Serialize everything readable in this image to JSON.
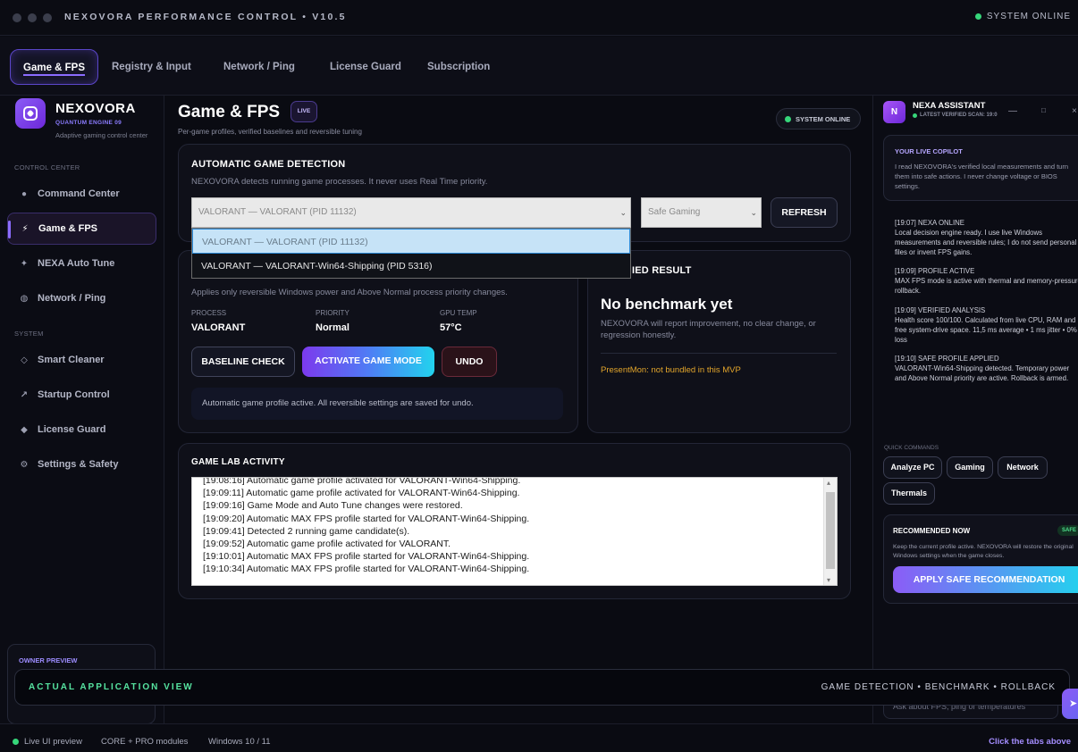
{
  "window": {
    "title": "NEXOVORA PERFORMANCE CONTROL • V10.5",
    "status": "SYSTEM ONLINE"
  },
  "tabs": [
    {
      "label": "Game & FPS"
    },
    {
      "label": "Registry & Input"
    },
    {
      "label": "Network / Ping"
    },
    {
      "label": "License Guard"
    },
    {
      "label": "Subscription"
    }
  ],
  "sidebar": {
    "brand": "NEXOVORA",
    "engine": "QUANTUM ENGINE 09",
    "tagline": "Adaptive gaming control center",
    "section_control": "CONTROL CENTER",
    "section_system": "SYSTEM",
    "items": [
      {
        "label": "Command Center",
        "icon": "grid-dot-icon"
      },
      {
        "label": "Game & FPS",
        "icon": "bolt-icon"
      },
      {
        "label": "NEXA Auto Tune",
        "icon": "sparkle-icon"
      },
      {
        "label": "Network / Ping",
        "icon": "network-icon"
      },
      {
        "label": "Smart Cleaner",
        "icon": "diamond-icon"
      },
      {
        "label": "Startup Control",
        "icon": "arrow-icon"
      },
      {
        "label": "License Guard",
        "icon": "shield-icon"
      },
      {
        "label": "Settings & Safety",
        "icon": "gear-icon"
      }
    ],
    "owner_preview": "OWNER PREVIEW"
  },
  "main": {
    "title": "Game & FPS",
    "badge": "LIVE",
    "subtitle": "Per-game profiles, verified baselines and reversible tuning",
    "system_pill": "SYSTEM ONLINE",
    "detection": {
      "heading": "AUTOMATIC GAME DETECTION",
      "description": "NEXOVORA detects running game processes. It never uses Real Time priority.",
      "selected_process": "VALORANT — VALORANT (PID 11132)",
      "mode_value": "Safe Gaming",
      "refresh_label": "REFRESH",
      "dropdown_options": [
        "VALORANT — VALORANT (PID 11132)",
        "VALORANT — VALORANT-Win64-Shipping (PID 5316)"
      ]
    },
    "game_mode": {
      "description": "Applies only reversible Windows power and Above Normal process priority changes.",
      "stats": [
        {
          "label": "PROCESS",
          "value": "VALORANT"
        },
        {
          "label": "PRIORITY",
          "value": "Normal"
        },
        {
          "label": "GPU TEMP",
          "value": "57°C"
        }
      ],
      "baseline_label": "BASELINE CHECK",
      "activate_label": "ACTIVATE GAME MODE",
      "undo_label": "UNDO",
      "notice": "Automatic game profile active. All reversible settings are saved for undo."
    },
    "benchmark": {
      "heading": "IED RESULT",
      "result": "No benchmark yet",
      "description": "NEXOVORA will report improvement, no clear change, or regression honestly.",
      "presentmon": "PresentMon: not bundled in this MVP"
    },
    "activity": {
      "heading": "GAME LAB ACTIVITY",
      "lines": [
        "[19:08:16] Automatic game profile activated for VALORANT-Win64-Shipping.",
        "[19:09:11] Automatic game profile activated for VALORANT-Win64-Shipping.",
        "[19:09:16] Game Mode and Auto Tune changes were restored.",
        "[19:09:20] Automatic MAX FPS profile started for VALORANT-Win64-Shipping.",
        "[19:09:41] Detected 2 running game candidate(s).",
        "[19:09:52] Automatic game profile activated for VALORANT.",
        "[19:10:01] Automatic MAX FPS profile started for VALORANT-Win64-Shipping.",
        "[19:10:34] Automatic MAX FPS profile started for VALORANT-Win64-Shipping."
      ]
    }
  },
  "assistant": {
    "name": "NEXA ASSISTANT",
    "scan": "LATEST VERIFIED SCAN: 19:0",
    "copilot_heading": "YOUR LIVE COPILOT",
    "copilot_text": "I read NEXOVORA's verified local measurements and turn them into safe actions. I never change voltage or BIOS settings.",
    "messages": [
      {
        "title": "[19:07] NEXA ONLINE",
        "body": "Local decision engine ready. I use live Windows measurements and reversible rules; I do not send personal files or invent FPS gains."
      },
      {
        "title": "[19:09] PROFILE ACTIVE",
        "body": "MAX FPS mode is active with thermal and memory-pressure rollback."
      },
      {
        "title": "[19:09] VERIFIED ANALYSIS",
        "body": "Health score 100/100. Calculated from live CPU, RAM and free system-drive space. 11,5 ms average • 1 ms jitter • 0% loss"
      },
      {
        "title": "[19:10] SAFE PROFILE APPLIED",
        "body": "VALORANT-Win64-Shipping detected. Temporary power and Above Normal priority are active. Rollback is armed."
      }
    ],
    "quick_heading": "QUICK COMMANDS",
    "quick": [
      "Analyze PC",
      "Gaming",
      "Network",
      "Thermals"
    ],
    "reco_heading": "RECOMMENDED NOW",
    "reco_badge": "SAFE",
    "reco_text": "Keep the current profile active. NEXOVORA will restore the original Windows settings when the game closes.",
    "apply_label": "APPLY SAFE RECOMMENDATION",
    "input_placeholder": "Ask about FPS, ping or temperatures"
  },
  "banner": {
    "left": "ACTUAL APPLICATION VIEW",
    "right": "GAME DETECTION • BENCHMARK • ROLLBACK"
  },
  "statusbar": {
    "preview": "Live UI preview",
    "modules": "CORE + PRO modules",
    "os": "Windows 10 / 11",
    "hint": "Click the tabs above"
  },
  "colors": {
    "accent": "#8b6cff",
    "online": "#36d67a",
    "warning": "#e2a52b",
    "banner_text": "#56e3a0"
  }
}
